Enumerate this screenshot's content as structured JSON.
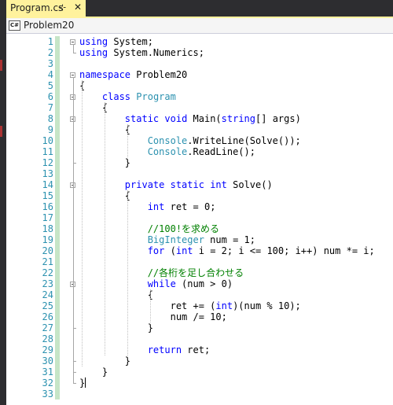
{
  "tab": {
    "label": "Program.cs",
    "pin": "⊹",
    "close": "✕"
  },
  "navbar": {
    "icon_text": "C#",
    "selected": "Problem20"
  },
  "editor": {
    "line_numbers": [
      "1",
      "2",
      "3",
      "4",
      "5",
      "6",
      "7",
      "8",
      "9",
      "10",
      "11",
      "12",
      "13",
      "14",
      "15",
      "16",
      "17",
      "18",
      "19",
      "20",
      "21",
      "22",
      "23",
      "24",
      "25",
      "26",
      "27",
      "28",
      "29",
      "30",
      "31",
      "32",
      "33"
    ],
    "lines": [
      [
        {
          "t": "using",
          "c": "kw"
        },
        {
          "t": " System;",
          "c": ""
        }
      ],
      [
        {
          "t": "using",
          "c": "kw"
        },
        {
          "t": " System.Numerics;",
          "c": ""
        }
      ],
      [],
      [
        {
          "t": "namespace",
          "c": "kw"
        },
        {
          "t": " Problem20",
          "c": ""
        }
      ],
      [
        {
          "t": "{",
          "c": ""
        }
      ],
      [
        {
          "t": "    ",
          "c": ""
        },
        {
          "t": "class",
          "c": "kw"
        },
        {
          "t": " ",
          "c": ""
        },
        {
          "t": "Program",
          "c": "ty"
        }
      ],
      [
        {
          "t": "    {",
          "c": ""
        }
      ],
      [
        {
          "t": "        ",
          "c": ""
        },
        {
          "t": "static",
          "c": "kw"
        },
        {
          "t": " ",
          "c": ""
        },
        {
          "t": "void",
          "c": "kw"
        },
        {
          "t": " Main(",
          "c": ""
        },
        {
          "t": "string",
          "c": "kw"
        },
        {
          "t": "[] args)",
          "c": ""
        }
      ],
      [
        {
          "t": "        {",
          "c": ""
        }
      ],
      [
        {
          "t": "            ",
          "c": ""
        },
        {
          "t": "Console",
          "c": "ty"
        },
        {
          "t": ".WriteLine(Solve());",
          "c": ""
        }
      ],
      [
        {
          "t": "            ",
          "c": ""
        },
        {
          "t": "Console",
          "c": "ty"
        },
        {
          "t": ".ReadLine();",
          "c": ""
        }
      ],
      [
        {
          "t": "        }",
          "c": ""
        }
      ],
      [],
      [
        {
          "t": "        ",
          "c": ""
        },
        {
          "t": "private",
          "c": "kw"
        },
        {
          "t": " ",
          "c": ""
        },
        {
          "t": "static",
          "c": "kw"
        },
        {
          "t": " ",
          "c": ""
        },
        {
          "t": "int",
          "c": "kw"
        },
        {
          "t": " Solve()",
          "c": ""
        }
      ],
      [
        {
          "t": "        {",
          "c": ""
        }
      ],
      [
        {
          "t": "            ",
          "c": ""
        },
        {
          "t": "int",
          "c": "kw"
        },
        {
          "t": " ret = 0;",
          "c": ""
        }
      ],
      [],
      [
        {
          "t": "            ",
          "c": ""
        },
        {
          "t": "//100!を求める",
          "c": "cm"
        }
      ],
      [
        {
          "t": "            ",
          "c": ""
        },
        {
          "t": "BigInteger",
          "c": "ty"
        },
        {
          "t": " num = 1;",
          "c": ""
        }
      ],
      [
        {
          "t": "            ",
          "c": ""
        },
        {
          "t": "for",
          "c": "kw"
        },
        {
          "t": " (",
          "c": ""
        },
        {
          "t": "int",
          "c": "kw"
        },
        {
          "t": " i = 2; i <= 100; i++) num *= i;",
          "c": ""
        }
      ],
      [],
      [
        {
          "t": "            ",
          "c": ""
        },
        {
          "t": "//各桁を足し合わせる",
          "c": "cm"
        }
      ],
      [
        {
          "t": "            ",
          "c": ""
        },
        {
          "t": "while",
          "c": "kw"
        },
        {
          "t": " (num > 0)",
          "c": ""
        }
      ],
      [
        {
          "t": "            {",
          "c": ""
        }
      ],
      [
        {
          "t": "                ret += (",
          "c": ""
        },
        {
          "t": "int",
          "c": "kw"
        },
        {
          "t": ")(num % 10);",
          "c": ""
        }
      ],
      [
        {
          "t": "                num /= 10;",
          "c": ""
        }
      ],
      [
        {
          "t": "            }",
          "c": ""
        }
      ],
      [],
      [
        {
          "t": "            ",
          "c": ""
        },
        {
          "t": "return",
          "c": "kw"
        },
        {
          "t": " ret;",
          "c": ""
        }
      ],
      [
        {
          "t": "        }",
          "c": ""
        }
      ],
      [
        {
          "t": "    }",
          "c": ""
        }
      ],
      [
        {
          "t": "}",
          "c": ""
        }
      ],
      []
    ]
  }
}
